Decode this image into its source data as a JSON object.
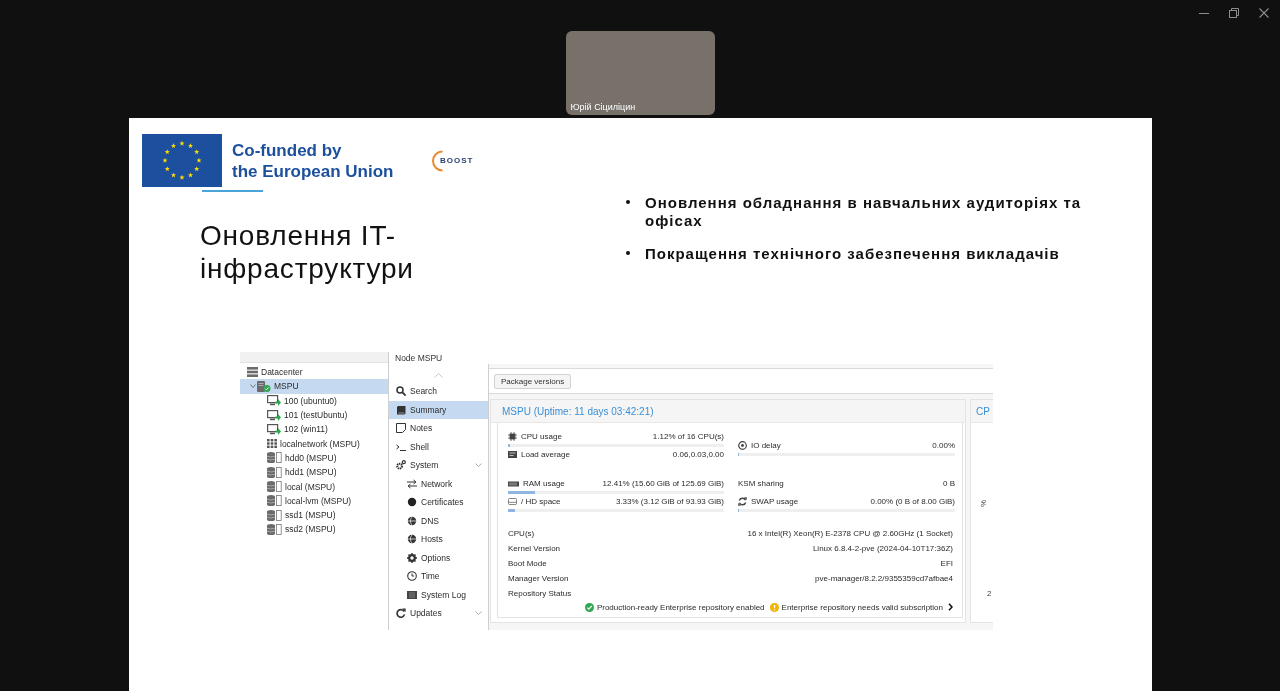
{
  "participant": {
    "name": "Юрій Сіциліцин"
  },
  "slide": {
    "eu_logo": {
      "lines": [
        "Co-funded by",
        "the European Union"
      ]
    },
    "partner_logo": {
      "text": "BOOST"
    },
    "title": "Оновлення IT-інфраструктури",
    "bullets": [
      "Оновлення обладнання в навчальних аудиторіях та офісах",
      "Покращення технічного забезпечення викладачів"
    ],
    "screenshot": {
      "view_title": "Node MSPU",
      "tree": [
        {
          "label": "Datacenter",
          "kind": "datacenter",
          "selected": false,
          "children": [
            {
              "label": "MSPU",
              "kind": "node",
              "selected": true,
              "expanded": true,
              "online": true,
              "children": [
                {
                  "label": "100 (ubuntu0)",
                  "kind": "vm",
                  "running": true,
                  "selected": false
                },
                {
                  "label": "101 (testUbuntu)",
                  "kind": "vm",
                  "running": true,
                  "selected": false
                },
                {
                  "label": "102 (win11)",
                  "kind": "vm",
                  "running": true,
                  "selected": false
                },
                {
                  "label": "localnetwork (MSPU)",
                  "kind": "network",
                  "selected": false
                },
                {
                  "label": "hdd0 (MSPU)",
                  "kind": "storage",
                  "selected": false
                },
                {
                  "label": "hdd1 (MSPU)",
                  "kind": "storage",
                  "selected": false
                },
                {
                  "label": "local (MSPU)",
                  "kind": "storage",
                  "selected": false
                },
                {
                  "label": "local-lvm (MSPU)",
                  "kind": "storage",
                  "selected": false
                },
                {
                  "label": "ssd1 (MSPU)",
                  "kind": "storage",
                  "selected": false
                },
                {
                  "label": "ssd2 (MSPU)",
                  "kind": "storage",
                  "selected": false
                }
              ]
            }
          ]
        }
      ],
      "nav": [
        {
          "label": "Search",
          "kind": "item",
          "selected": false
        },
        {
          "label": "Summary",
          "kind": "item",
          "selected": true
        },
        {
          "label": "Notes",
          "kind": "item",
          "selected": false
        },
        {
          "label": "Shell",
          "kind": "item",
          "selected": false
        },
        {
          "label": "System",
          "kind": "group",
          "selected": false,
          "children": [
            {
              "label": "Network",
              "selected": false
            },
            {
              "label": "Certificates",
              "selected": false
            },
            {
              "label": "DNS",
              "selected": false
            },
            {
              "label": "Hosts",
              "selected": false
            },
            {
              "label": "Options",
              "selected": false
            },
            {
              "label": "Time",
              "selected": false
            },
            {
              "label": "System Log",
              "selected": false
            }
          ]
        },
        {
          "label": "Updates",
          "kind": "group",
          "selected": false
        }
      ],
      "toolbar": {
        "button": "Package versions"
      },
      "summary": {
        "title": "MSPU (Uptime: 11 days 03:42:21)",
        "stat_blocks": [
          {
            "items": [
              {
                "kind": "meter",
                "label": "CPU usage",
                "value": "1.12% of 16 CPU(s)",
                "level": 0.0112
              },
              {
                "kind": "text",
                "label": "Load average",
                "value": "0.06,0.03,0.00"
              }
            ]
          },
          {
            "items": [
              {
                "kind": "meter",
                "label": "IO delay",
                "value": "0.00%",
                "level": 0
              }
            ]
          },
          {
            "items": [
              {
                "kind": "meter",
                "label": "RAM usage",
                "value": "12.41% (15.60 GiB of 125.69 GiB)",
                "level": 0.1241
              },
              {
                "kind": "meter",
                "label": "/ HD space",
                "value": "3.33% (3.12 GiB of 93.93 GiB)",
                "level": 0.0333
              }
            ]
          },
          {
            "items": [
              {
                "kind": "text",
                "label": "KSM sharing",
                "value": "0 B"
              },
              {
                "kind": "meter",
                "label": "SWAP usage",
                "value": "0.00% (0 B of 8.00 GiB)",
                "level": 0
              }
            ]
          }
        ],
        "info": [
          {
            "label": "CPU(s)",
            "value": "16 x Intel(R) Xeon(R) E-2378 CPU @ 2.60GHz (1 Socket)"
          },
          {
            "label": "Kernel Version",
            "value": "Linux 6.8.4-2-pve (2024-04-10T17:36Z)"
          },
          {
            "label": "Boot Mode",
            "value": "EFI"
          },
          {
            "label": "Manager Version",
            "value": "pve-manager/8.2.2/9355359cd7afbae4"
          },
          {
            "label": "Repository Status"
          }
        ],
        "repository": [
          {
            "kind": "ok",
            "text": "Production-ready Enterprise repository enabled"
          },
          {
            "kind": "warning",
            "text": "Enterprise repository needs valid subscription"
          }
        ]
      },
      "cpu_panel": {
        "title": "CP",
        "ylabel": "%",
        "tick": "2"
      }
    }
  }
}
